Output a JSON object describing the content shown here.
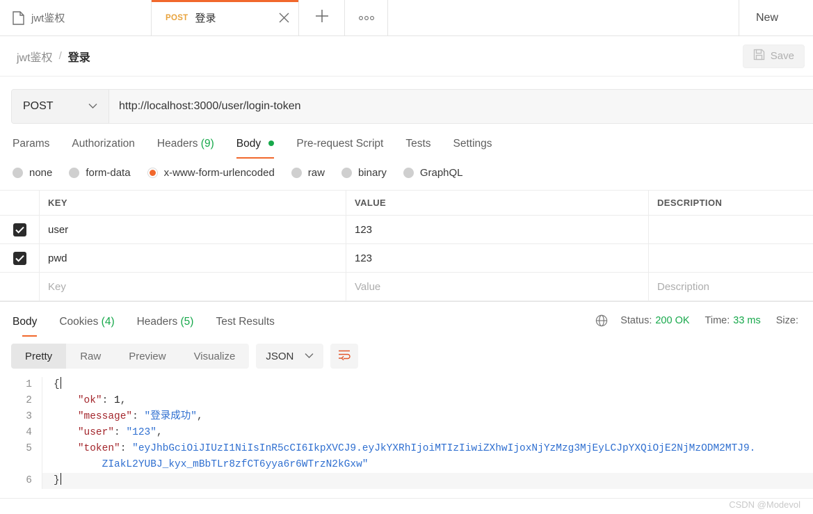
{
  "tabs": {
    "collection_tab": {
      "label": "jwt鉴权",
      "icon": "document-icon"
    },
    "active_tab": {
      "method": "POST",
      "label": "登录"
    },
    "new_tab_icon": "plus-icon",
    "more_icon": "ellipsis-icon",
    "new_button": "New"
  },
  "breadcrumb": {
    "parent": "jwt鉴权",
    "separator": "/",
    "current": "登录",
    "save_label": "Save",
    "save_icon": "floppy-disk-icon"
  },
  "request": {
    "method": "POST",
    "url": "http://localhost:3000/user/login-token",
    "tabs": [
      {
        "label": "Params",
        "count": "",
        "active": false
      },
      {
        "label": "Authorization",
        "count": "",
        "active": false
      },
      {
        "label": "Headers",
        "count": "(9)",
        "active": false
      },
      {
        "label": "Body",
        "count": "",
        "active": true,
        "dot": true
      },
      {
        "label": "Pre-request Script",
        "count": "",
        "active": false
      },
      {
        "label": "Tests",
        "count": "",
        "active": false
      },
      {
        "label": "Settings",
        "count": "",
        "active": false
      }
    ],
    "body_types": [
      {
        "label": "none",
        "selected": false
      },
      {
        "label": "form-data",
        "selected": false
      },
      {
        "label": "x-www-form-urlencoded",
        "selected": true
      },
      {
        "label": "raw",
        "selected": false
      },
      {
        "label": "binary",
        "selected": false
      },
      {
        "label": "GraphQL",
        "selected": false
      }
    ],
    "table": {
      "headers": {
        "key": "KEY",
        "value": "VALUE",
        "description": "DESCRIPTION"
      },
      "rows": [
        {
          "checked": true,
          "key": "user",
          "value": "123",
          "description": ""
        },
        {
          "checked": true,
          "key": "pwd",
          "value": "123",
          "description": ""
        }
      ],
      "placeholder_row": {
        "key": "Key",
        "value": "Value",
        "description": "Description"
      }
    }
  },
  "response": {
    "tabs": [
      {
        "label": "Body",
        "count": "",
        "active": true
      },
      {
        "label": "Cookies",
        "count": "(4)",
        "active": false
      },
      {
        "label": "Headers",
        "count": "(5)",
        "active": false
      },
      {
        "label": "Test Results",
        "count": "",
        "active": false
      }
    ],
    "status": {
      "globe_icon": "globe-icon",
      "status_label": "Status:",
      "status_value": "200 OK",
      "time_label": "Time:",
      "time_value": "33 ms",
      "size_label": "Size:"
    },
    "view_modes": [
      {
        "label": "Pretty",
        "active": true
      },
      {
        "label": "Raw",
        "active": false
      },
      {
        "label": "Preview",
        "active": false
      },
      {
        "label": "Visualize",
        "active": false
      }
    ],
    "format": "JSON",
    "wrap_icon": "word-wrap-icon",
    "body": {
      "line_numbers": [
        "1",
        "2",
        "3",
        "4",
        "5",
        "6"
      ],
      "fields": {
        "ok_key": "\"ok\"",
        "ok_value": "1",
        "message_key": "\"message\"",
        "message_value": "\"登录成功\"",
        "user_key": "\"user\"",
        "user_value": "\"123\"",
        "token_key": "\"token\"",
        "token_value_line1": "\"eyJhbGciOiJIUzI1NiIsInR5cCI6IkpXVCJ9.eyJkYXRhIjoiMTIzIiwiZXhwIjoxNjYzMzg3MjEyLCJpYXQiOjE2NjMzODM2MTJ9.",
        "token_value_line2": "ZIakL2YUBJ_kyx_mBbTLr8zfCT6yya6r6WTrzN2kGxw\"",
        "open_brace": "{",
        "close_brace": "}",
        "comma": ",",
        "colon": ": "
      }
    }
  },
  "watermark": "CSDN @Modevol"
}
